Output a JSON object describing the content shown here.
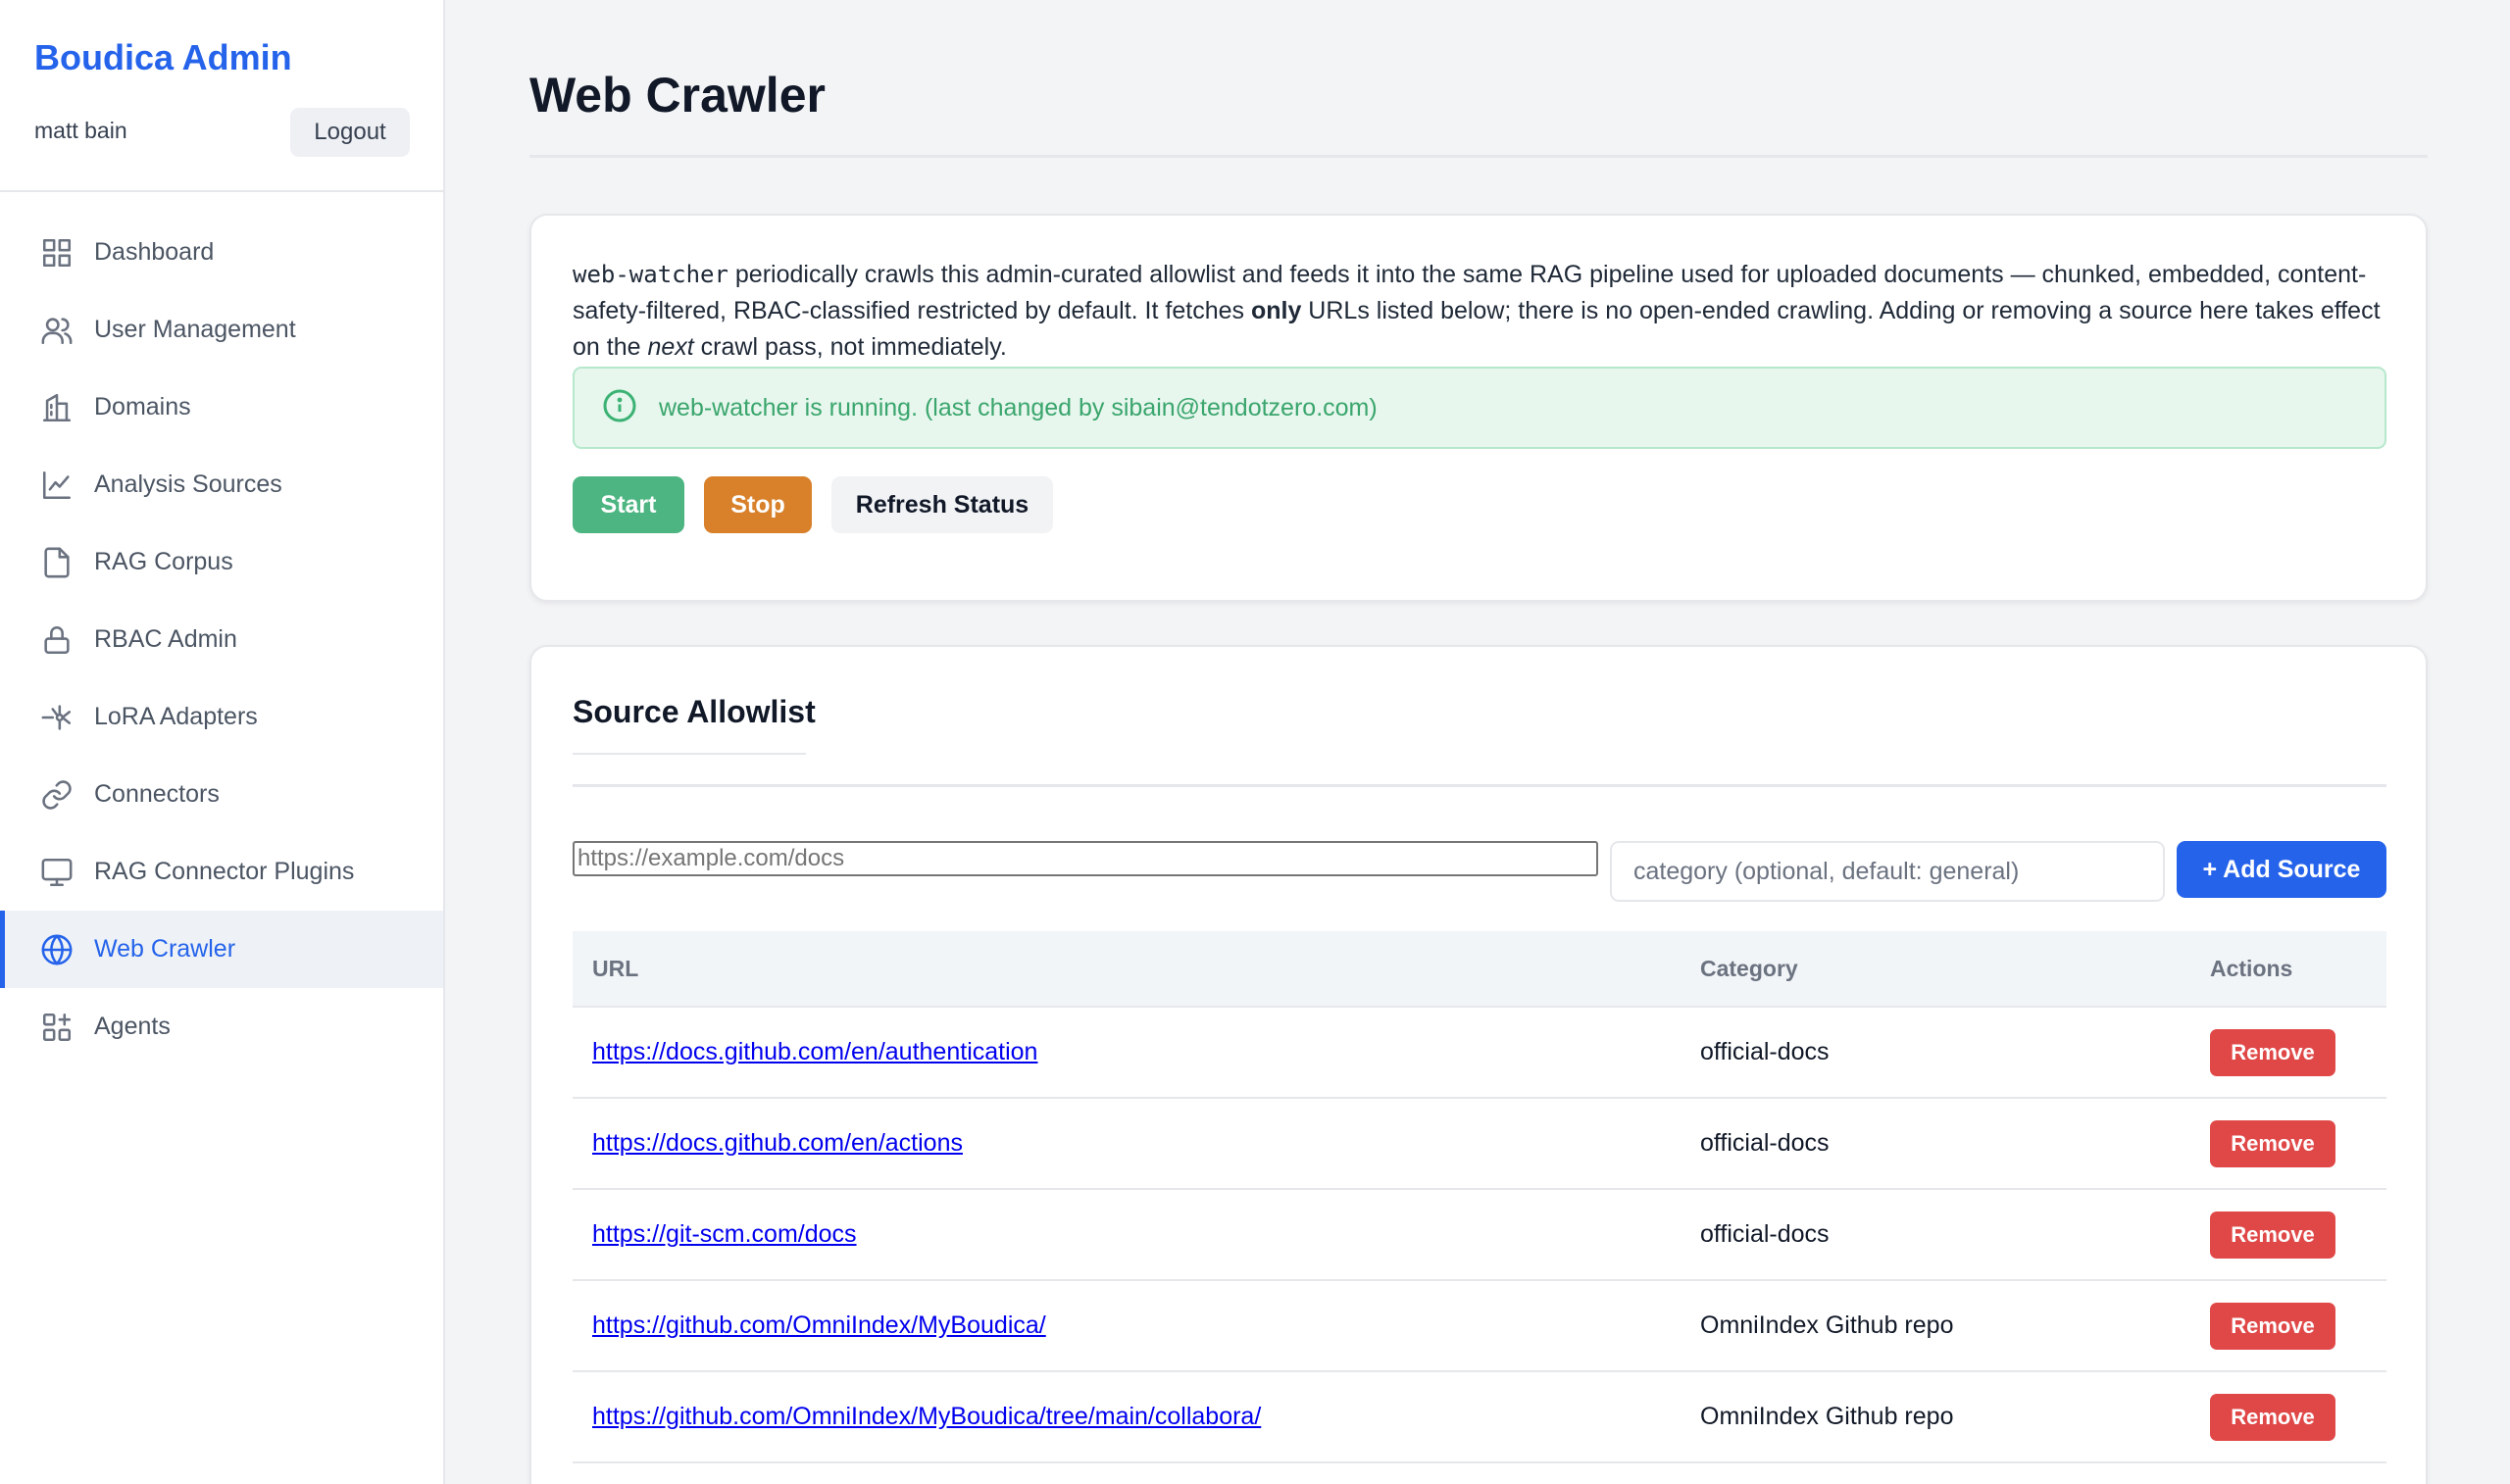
{
  "sidebar": {
    "brand": "Boudica Admin",
    "user": "matt bain",
    "logout_label": "Logout",
    "items": [
      {
        "label": "Dashboard",
        "icon": "grid-icon",
        "active": false
      },
      {
        "label": "User Management",
        "icon": "users-icon",
        "active": false
      },
      {
        "label": "Domains",
        "icon": "building-icon",
        "active": false
      },
      {
        "label": "Analysis Sources",
        "icon": "chart-line-icon",
        "active": false
      },
      {
        "label": "RAG Corpus",
        "icon": "file-icon",
        "active": false
      },
      {
        "label": "RBAC Admin",
        "icon": "lock-icon",
        "active": false
      },
      {
        "label": "LoRA Adapters",
        "icon": "adapter-icon",
        "active": false
      },
      {
        "label": "Connectors",
        "icon": "link-icon",
        "active": false
      },
      {
        "label": "RAG Connector Plugins",
        "icon": "monitor-icon",
        "active": false
      },
      {
        "label": "Web Crawler",
        "icon": "globe-icon",
        "active": true
      },
      {
        "label": "Agents",
        "icon": "apps-icon",
        "active": false
      }
    ]
  },
  "main": {
    "title": "Web Crawler",
    "description": {
      "code": "web-watcher",
      "part1": " periodically crawls this admin-curated allowlist and feeds it into the same RAG pipeline used for uploaded documents — chunked, embedded, content-safety-filtered, RBAC-classified restricted by default. It fetches ",
      "bold": "only",
      "part2": " URLs listed below; there is no open-ended crawling. Adding or removing a source here takes effect on the ",
      "italic": "next",
      "part3": " crawl pass, not immediately."
    },
    "status": "web-watcher is running. (last changed by sibain@tendotzero.com)",
    "buttons": {
      "start": "Start",
      "stop": "Stop",
      "refresh": "Refresh Status"
    }
  },
  "allowlist": {
    "title": "Source Allowlist",
    "url_placeholder": "https://example.com/docs",
    "category_placeholder": "category (optional, default: general)",
    "add_label": "+ Add Source",
    "columns": {
      "url": "URL",
      "category": "Category",
      "actions": "Actions"
    },
    "remove_label": "Remove",
    "rows": [
      {
        "url": "https://docs.github.com/en/authentication",
        "category": "official-docs"
      },
      {
        "url": "https://docs.github.com/en/actions",
        "category": "official-docs"
      },
      {
        "url": "https://git-scm.com/docs",
        "category": "official-docs"
      },
      {
        "url": "https://github.com/OmniIndex/MyBoudica/",
        "category": "OmniIndex Github repo"
      },
      {
        "url": "https://github.com/OmniIndex/MyBoudica/tree/main/collabora/",
        "category": "OmniIndex Github repo"
      }
    ]
  },
  "colors": {
    "accent": "#2563eb",
    "success": "#4cb581",
    "warning": "#d8802a",
    "danger": "#e04848"
  }
}
